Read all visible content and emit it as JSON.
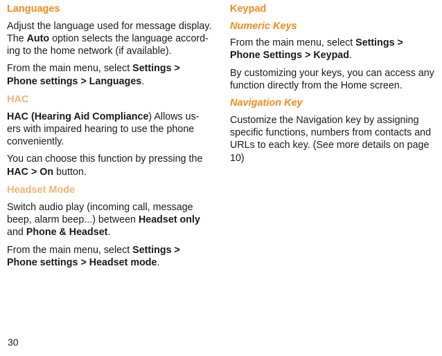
{
  "left": {
    "languages": {
      "title": "Languages",
      "p1a": "Adjust the language used for message display. The ",
      "p1b_bold": "Auto",
      "p1c": " option selects the language accord-ing to the home network (if available).",
      "p2a": "From the main menu, select ",
      "p2b_bold": "Settings > Phone settings > Languages",
      "p2c": "."
    },
    "hac": {
      "title": "HAC",
      "p1_bold": "HAC (Hearing Aid Compliance",
      "p1_mid": ") Allows us-ers with impaired hearing to use the phone conveniently.",
      "p2a": "You can choose this function by pressing the ",
      "p2b_bold": "HAC > On",
      "p2c": " button."
    },
    "headset": {
      "title": "Headset Mode",
      "p1a": "Switch audio play (incoming call, message beep, alarm beep...) between ",
      "p1b_bold": "Headset only",
      "p1c": " and ",
      "p1d_bold": "Phone & Headset",
      "p1e": ".",
      "p2a": "From the main menu, select ",
      "p2b_bold": "Settings > Phone settings > Headset mode",
      "p2c": "."
    }
  },
  "right": {
    "keypad": {
      "title": "Keypad",
      "numeric": {
        "title": "Numeric Keys",
        "p1a": "From the main menu, select ",
        "p1b_bold": "Settings > Phone Settings > Keypad",
        "p1c": ".",
        "p2": "By customizing your keys, you can access any function directly from the Home screen."
      },
      "nav": {
        "title": "Navigation Key",
        "p1": "Customize the Navigation key by assigning specific functions, numbers from contacts and URLs to each key. (See more details on page 10)"
      }
    }
  },
  "page_number": "30"
}
